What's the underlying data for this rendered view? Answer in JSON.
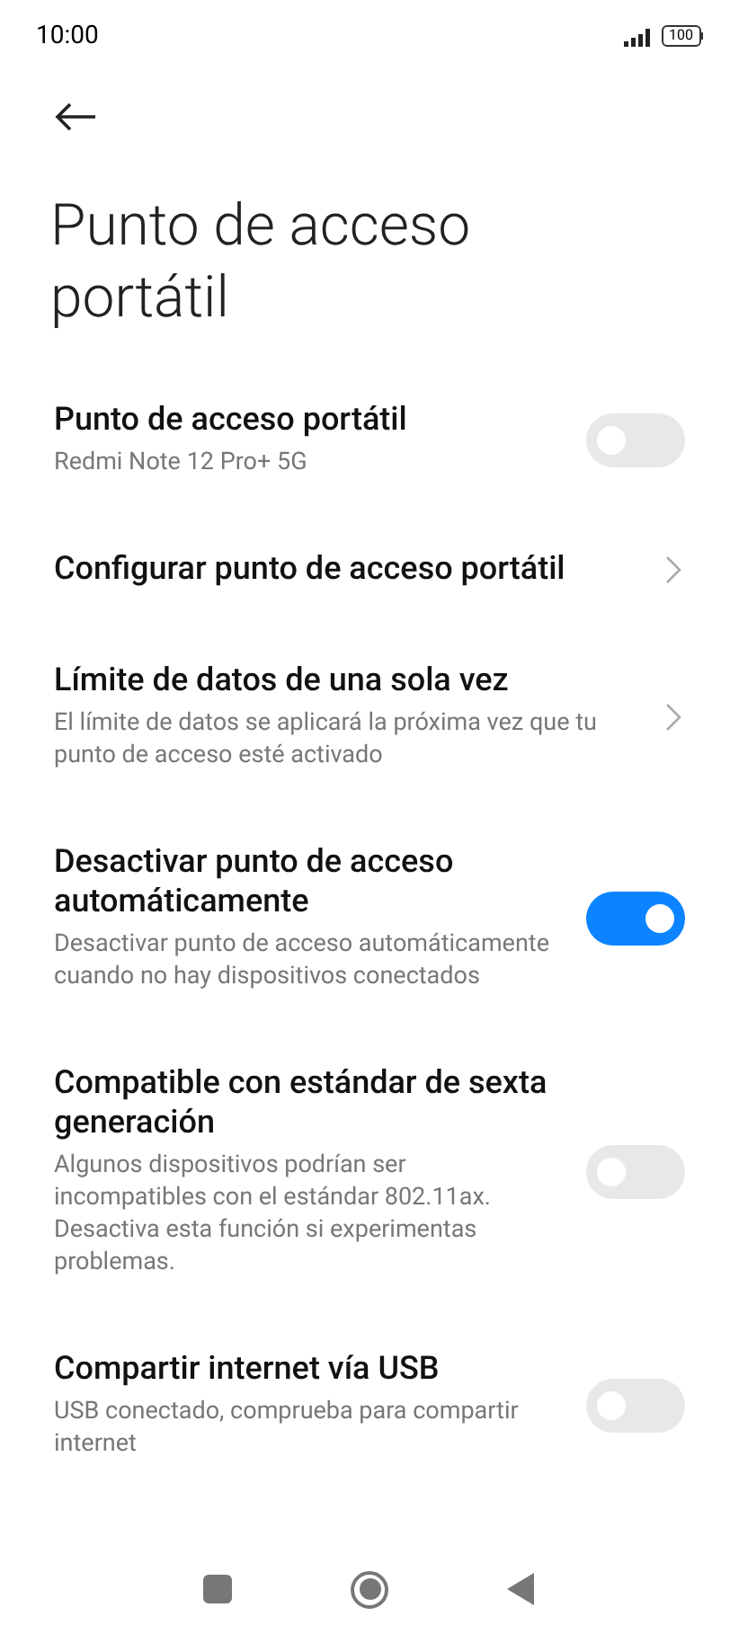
{
  "status_bar": {
    "time": "10:00",
    "battery": "100"
  },
  "title": "Punto de acceso portátil",
  "items": [
    {
      "kind": "toggle",
      "title": "Punto de acceso portátil",
      "subtitle": "Redmi Note 12 Pro+ 5G",
      "on": false
    },
    {
      "kind": "link",
      "title": "Configurar punto de acceso portátil"
    },
    {
      "kind": "link",
      "title": "Límite de datos de una sola vez",
      "subtitle": "El límite de datos se aplicará la próxima vez que tu punto de acceso esté activado"
    },
    {
      "kind": "toggle",
      "title": "Desactivar punto de acceso automáticamente",
      "subtitle": "Desactivar punto de acceso automáticamente cuando no hay dispositivos conectados",
      "on": true
    },
    {
      "kind": "toggle",
      "title": "Compatible con estándar de sexta generación",
      "subtitle": "Algunos dispositivos podrían ser incompatibles con el estándar 802.11ax. Desactiva esta función si experimentas problemas.",
      "on": false
    },
    {
      "kind": "toggle",
      "title": "Compartir internet vía USB",
      "subtitle": "USB conectado, comprueba para compartir internet",
      "on": false
    }
  ]
}
